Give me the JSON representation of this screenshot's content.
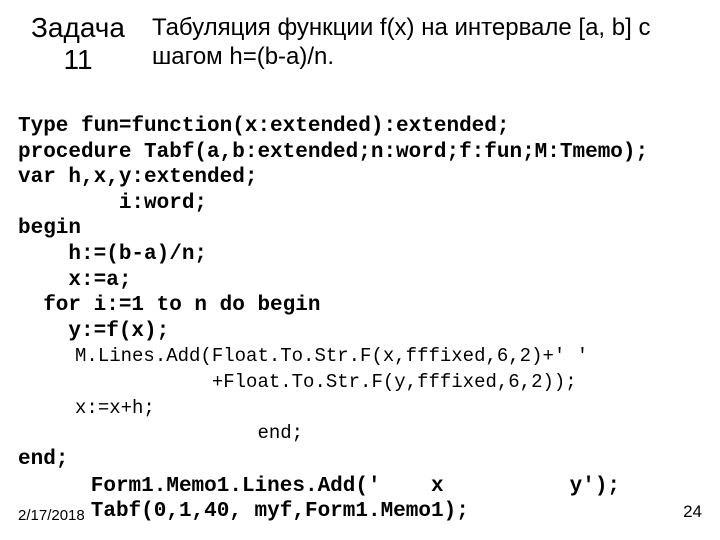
{
  "header": {
    "task_label_line1": "Задача",
    "task_label_line2": "11",
    "description": "Табуляция функции f(x) на интервале [a, b] с шагом h=(b-a)/n."
  },
  "code": {
    "l1": "Type fun=function(x:extended):extended;",
    "l2": "procedure Tabf(a,b:extended;n:word;f:fun;M:Tmemo);",
    "l3": "var h,x,y:extended;",
    "l4": "        i:word;",
    "l5": "begin",
    "l6": "    h:=(b-a)/n;",
    "l7": "    x:=a;",
    "l8": "  for i:=1 to n do begin",
    "l9": "    y:=f(x);",
    "l10": "     M.Lines.Add(Float.To.Str.F(x,fffixed,6,2)+' '",
    "l11": "                 +Float.To.Str.F(y,fffixed,6,2));",
    "l12": "     x:=x+h;",
    "l13": "                     end;",
    "l14": "end;"
  },
  "footer": {
    "date": "2/17/2018",
    "code_line1": "Form1.Memo1.Lines.Add('    x          y');",
    "code_line2": "Tabf(0,1,40, myf,Form1.Memo1);",
    "page": "24"
  }
}
